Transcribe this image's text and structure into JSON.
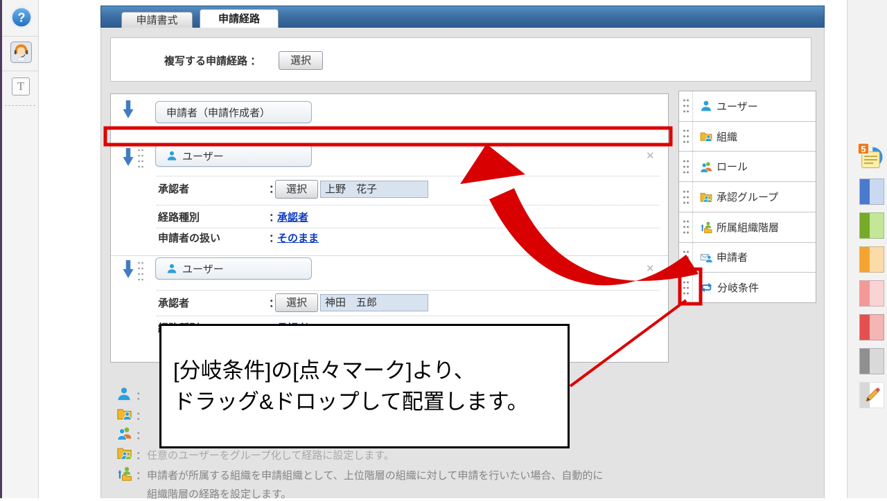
{
  "window": {
    "tabs": [
      {
        "label": "申請書式",
        "active": false
      },
      {
        "label": "申請経路",
        "active": true
      }
    ],
    "copy_section": {
      "label": "複写する申請経路",
      "colon": "：",
      "select_button": "選択"
    },
    "flow": {
      "start_node": {
        "label": "申請者（申請作成者）"
      },
      "blocks": [
        {
          "node_label": "ユーザー",
          "close": "✕",
          "fields": [
            {
              "label": "承認者",
              "colon": "：",
              "button": "選択",
              "value": "上野　花子"
            },
            {
              "label": "経路種別",
              "colon": "：",
              "link": "承認者"
            },
            {
              "label": "申請者の扱い",
              "colon": "：",
              "link": "そのまま"
            }
          ]
        },
        {
          "node_label": "ユーザー",
          "close": "✕",
          "fields": [
            {
              "label": "承認者",
              "colon": "：",
              "button": "選択",
              "value": "神田　五郎"
            },
            {
              "label": "経路種別",
              "colon": "：",
              "link": "承認者"
            }
          ]
        }
      ]
    },
    "palette": {
      "items": [
        {
          "label": "ユーザー"
        },
        {
          "label": "組織"
        },
        {
          "label": "ロール"
        },
        {
          "label": "承認グループ"
        },
        {
          "label": "所属組織階層"
        },
        {
          "label": "申請者"
        },
        {
          "label": "分岐条件"
        }
      ]
    },
    "legend": {
      "colon": "：",
      "rows": [
        {
          "text": ""
        },
        {
          "text": ""
        },
        {
          "text": ""
        },
        {
          "text": "任意のユーザーをグループ化して経路に設定します。"
        },
        {
          "text": "申請者が所属する組織を申請組織として、上位階層の組織に対して申請を行いたい場合、自動的に",
          "text2": "組織階層の経路を設定します。"
        }
      ]
    }
  },
  "annotation": {
    "line1": "[分岐条件]の[点々マーク]より、",
    "line2": "ドラッグ&ドロップして配置します。"
  },
  "sidebar": {
    "help_glyph": "?",
    "text_tool_glyph": "T"
  },
  "toolbar": {
    "note_badge": "5"
  },
  "colors": {
    "highlight_red": "#dc0202",
    "header_blue": "#3a6ca0",
    "link_blue": "#0b3bbf",
    "user_icon_blue": "#2aa0dc"
  }
}
